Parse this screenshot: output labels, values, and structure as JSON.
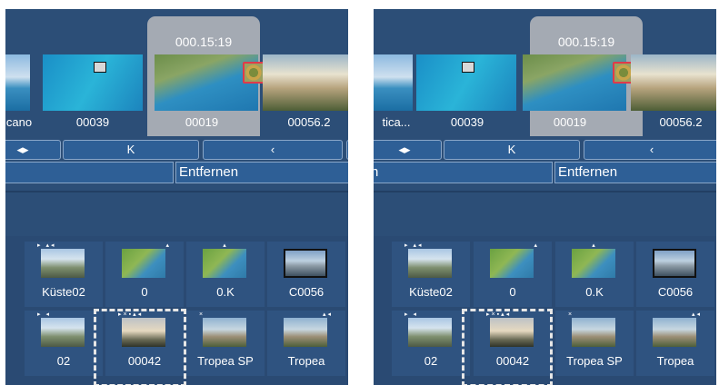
{
  "panels": [
    {
      "timecode": "000.15:19",
      "thumbnails": [
        "cano",
        "00039",
        "00019",
        "00056.2"
      ],
      "buttons": {
        "play": "◂▸",
        "start": "K",
        "prev": "‹"
      },
      "actions": {
        "left": "n",
        "remove": "Entfernen"
      },
      "grid": [
        [
          "Küste02",
          "0",
          "0.K",
          "C0056"
        ],
        [
          "02",
          "00042",
          "Tropea SP",
          "Tropea"
        ]
      ]
    },
    {
      "timecode": "000.15:19",
      "thumbnails": [
        "tica...",
        "00039",
        "00019",
        "00056.2"
      ],
      "buttons": {
        "play": "◂▸",
        "start": "K",
        "prev": "‹"
      },
      "actions": {
        "left": "n",
        "remove": "Entfernen"
      },
      "grid": [
        [
          "Küste02",
          "0",
          "0.K",
          "C0056"
        ],
        [
          "02",
          "00042",
          "Tropea SP",
          "Tropea"
        ]
      ]
    }
  ]
}
